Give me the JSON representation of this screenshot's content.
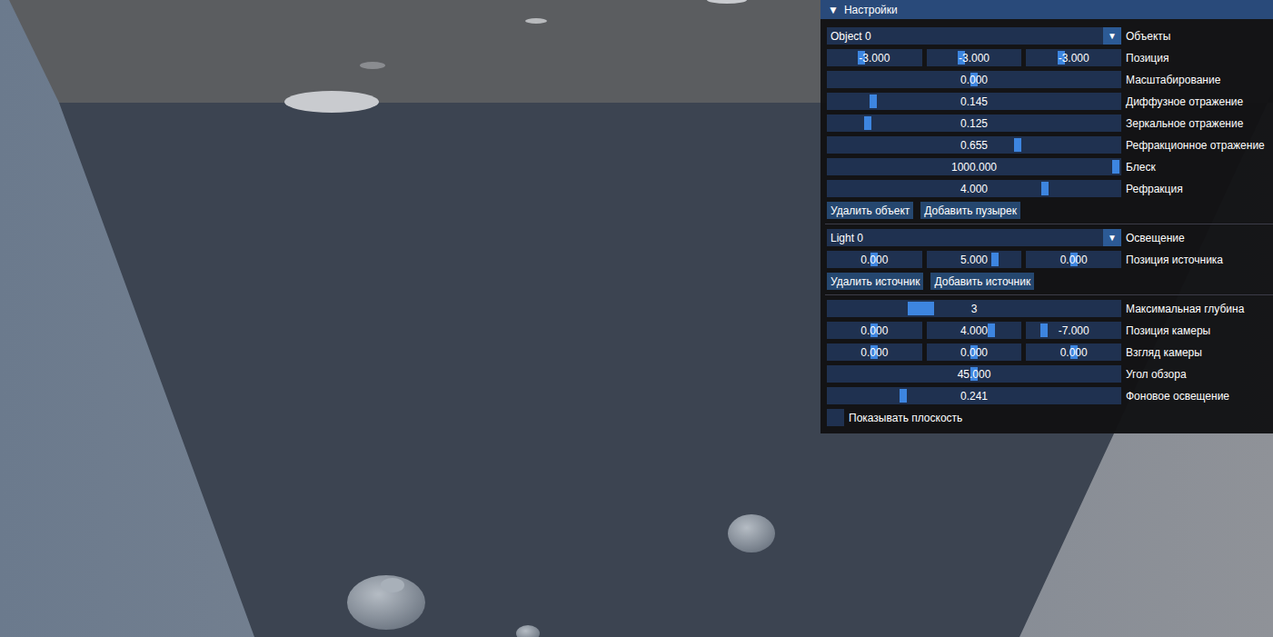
{
  "panel": {
    "title": "Настройки",
    "collapse_icon": "▼"
  },
  "sections": [
    {
      "rows": [
        {
          "kind": "combo",
          "value": "Object 0",
          "arrow": "▼",
          "label": "Объекты"
        },
        {
          "kind": "slider3",
          "values": [
            {
              "text": "-3.000",
              "level": 0.35
            },
            {
              "text": "-3.000",
              "level": 0.35
            },
            {
              "text": "-3.000",
              "level": 0.35
            }
          ],
          "label": "Позиция"
        },
        {
          "kind": "slider",
          "text": "0.000",
          "level": 0.5,
          "label": "Масштабирование"
        },
        {
          "kind": "slider",
          "text": "0.145",
          "level": 0.145,
          "label": "Диффузное отражение"
        },
        {
          "kind": "slider",
          "text": "0.125",
          "level": 0.125,
          "label": "Зеркальное отражение"
        },
        {
          "kind": "slider",
          "text": "0.655",
          "level": 0.655,
          "label": "Рефракционное отражение"
        },
        {
          "kind": "slider",
          "text": "1000.000",
          "level": 1.0,
          "label": "Блеск"
        },
        {
          "kind": "slider",
          "text": "4.000",
          "level": 0.75,
          "label": "Рефракция"
        },
        {
          "kind": "buttons",
          "buttons": [
            "Удалить объект",
            "Добавить пузырек"
          ]
        }
      ]
    },
    {
      "rows": [
        {
          "kind": "combo",
          "value": "Light 0",
          "arrow": "▼",
          "label": "Освещение"
        },
        {
          "kind": "slider3",
          "values": [
            {
              "text": "0.000",
              "level": 0.5
            },
            {
              "text": "5.000",
              "level": 0.75
            },
            {
              "text": "0.000",
              "level": 0.5
            }
          ],
          "label": "Позиция источника"
        },
        {
          "kind": "buttons",
          "buttons": [
            "Удалить источник",
            "Добавить источник"
          ]
        }
      ]
    },
    {
      "rows": [
        {
          "kind": "slider-int",
          "text": "3",
          "level": 0.3,
          "label": "Максимальная глубина"
        },
        {
          "kind": "slider3",
          "values": [
            {
              "text": "0.000",
              "level": 0.5
            },
            {
              "text": "4.000",
              "level": 0.7
            },
            {
              "text": "-7.000",
              "level": 0.15
            }
          ],
          "label": "Позиция камеры"
        },
        {
          "kind": "slider3",
          "values": [
            {
              "text": "0.000",
              "level": 0.5
            },
            {
              "text": "0.000",
              "level": 0.5
            },
            {
              "text": "0.000",
              "level": 0.5
            }
          ],
          "label": "Взгляд камеры"
        },
        {
          "kind": "slider",
          "text": "45.000",
          "level": 0.5,
          "label": "Угол обзора"
        },
        {
          "kind": "slider",
          "text": "0.241",
          "level": 0.25,
          "label": "Фоновое освещение"
        },
        {
          "kind": "checkbox",
          "checked": false,
          "label": "Показывать плоскость"
        }
      ]
    }
  ]
}
